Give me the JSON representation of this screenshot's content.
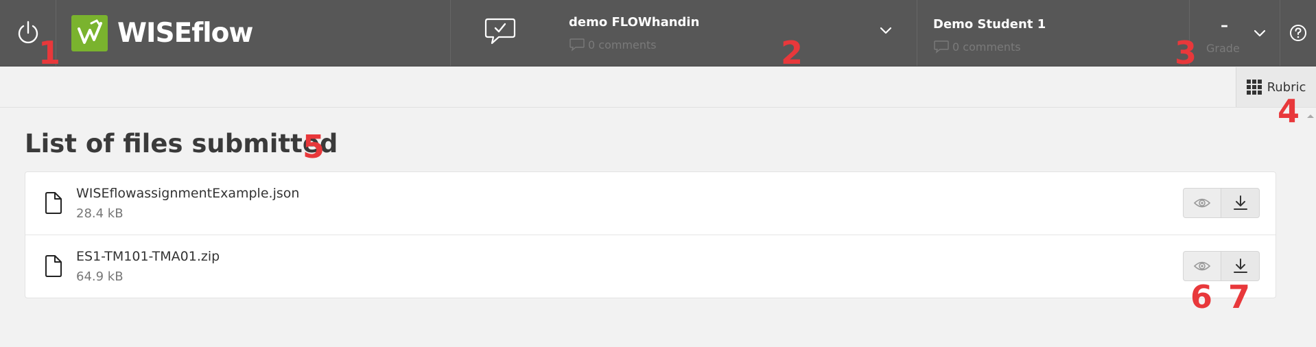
{
  "header": {
    "brand": "WISEflow",
    "assignment": {
      "title": "demo FLOWhandin",
      "comments": "0 comments"
    },
    "student": {
      "name": "Demo Student 1",
      "comments": "0 comments"
    },
    "grade": {
      "value": "–",
      "label": "Grade"
    }
  },
  "toolbar": {
    "rubric_label": "Rubric"
  },
  "main": {
    "title": "List of files submitted",
    "files": [
      {
        "name": "WISEflowassignmentExample.json",
        "size": "28.4 kB"
      },
      {
        "name": "ES1-TM101-TMA01.zip",
        "size": "64.9 kB"
      }
    ]
  },
  "markers": [
    "1",
    "2",
    "3",
    "4",
    "5",
    "6",
    "7"
  ],
  "colors": {
    "header_bg": "#575757",
    "brand_green": "#7ab32e",
    "marker_red": "#e8383b"
  }
}
